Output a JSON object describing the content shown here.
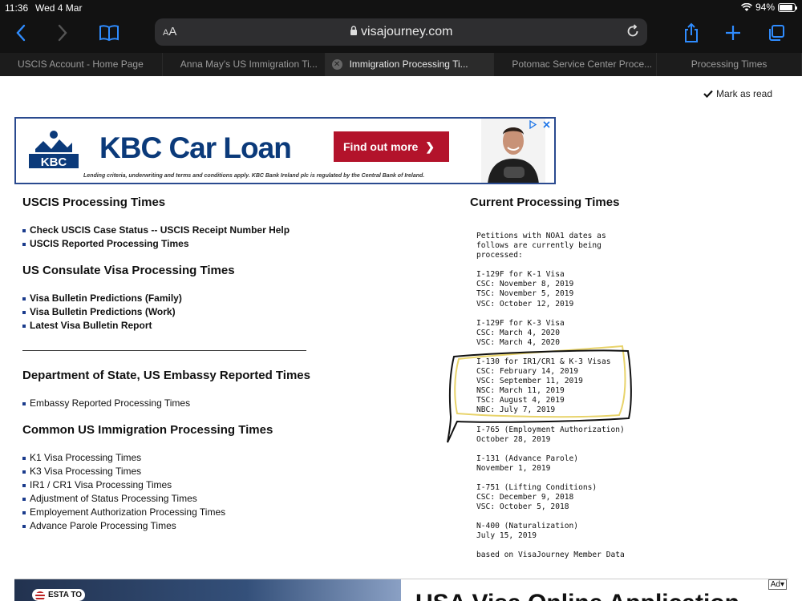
{
  "status": {
    "time": "11:36",
    "date": "Wed 4 Mar",
    "battery": "94%"
  },
  "browser": {
    "text_size": "AA",
    "url": "visajourney.com",
    "icons": [
      "back-icon",
      "forward-icon",
      "bookmarks-icon",
      "lock-icon",
      "reload-icon",
      "share-icon",
      "new-tab-icon",
      "tabs-icon"
    ],
    "tabs": [
      {
        "label": "USCIS Account - Home Page"
      },
      {
        "label": "Anna May's US Immigration Ti..."
      },
      {
        "label": "Immigration Processing Ti...",
        "active": true
      },
      {
        "label": "Potomac Service Center Proce..."
      },
      {
        "label": "Processing Times"
      }
    ]
  },
  "page": {
    "mark_as_read": "Mark as read",
    "ad": {
      "logo_text": "KBC",
      "headline": "KBC Car Loan",
      "cta": "Find out more",
      "cta_chevron": "❯",
      "fine_print": "Lending criteria, underwriting and terms and conditions apply. KBC Bank Ireland plc is regulated by the Central Bank of Ireland.",
      "brand_color": "#0b3a7a",
      "cta_color": "#b3132b"
    },
    "uscis": {
      "heading": "USCIS Processing Times",
      "links": [
        "Check USCIS Case Status -- USCIS Receipt Number Help",
        "USCIS Reported Processing Times"
      ]
    },
    "consulate": {
      "heading": "US Consulate Visa Processing Times",
      "links": [
        "Visa Bulletin Predictions (Family)",
        "Visa Bulletin Predictions (Work)",
        "Latest Visa Bulletin Report"
      ]
    },
    "state": {
      "heading": "Department of State, US Embassy Reported Times",
      "links": [
        "Embassy Reported Processing Times"
      ]
    },
    "common": {
      "heading": "Common US Immigration Processing Times",
      "links": [
        "K1 Visa Processing Times",
        "K3 Visa Processing Times",
        "IR1 / CR1 Visa Processing Times",
        "Adjustment of Status Processing Times",
        "Employement Authorization Processing Times",
        "Advance Parole Processing Times"
      ]
    },
    "current": {
      "heading": "Current Processing Times",
      "intro": "Petitions with NOA1 dates as\nfollows are currently being\nprocessed:",
      "blocks": [
        "I-129F for K-1 Visa\nCSC: November 8, 2019\nTSC: November 5, 2019\nVSC: October 12, 2019",
        "I-129F for K-3 Visa\nCSC: March 4, 2020\nVSC: March 4, 2020",
        "I-130 for IR1/CR1 & K-3 Visas\nCSC: February 14, 2019\nVSC: September 11, 2019\nNSC: March 11, 2019\nTSC: August 4, 2019\nNBC: July 7, 2019",
        "I-765 (Employment Authorization)\nOctober 28, 2019",
        "I-131 (Advance Parole)\nNovember 1, 2019",
        "I-751 (Lifting Conditions)\nCSC: December 9, 2018\nVSC: October 5, 2018",
        "N-400 (Naturalization)\nJuly 15, 2019"
      ],
      "footer": "based on VisaJourney Member Data"
    },
    "bottom_ad": {
      "badge": "ESTA TO",
      "title": "USA Visa Online Application",
      "ad_tag": "Ad▾"
    },
    "annotation_colors": {
      "outline": "#111111",
      "highlight": "#e8d36a"
    }
  }
}
